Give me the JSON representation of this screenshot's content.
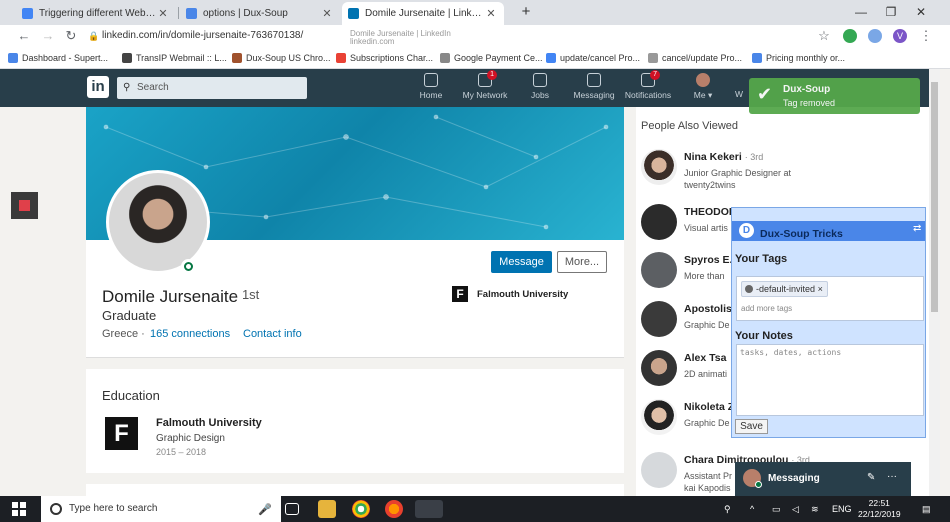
{
  "browser": {
    "tabs": [
      {
        "title": "Triggering different Webhooks fr",
        "icon": "docs-icon",
        "active": false
      },
      {
        "title": "options | Dux-Soup",
        "icon": "duxsoup-icon",
        "active": false
      },
      {
        "title": "Domile Jursenaite | LinkedIn",
        "icon": "linkedin-icon",
        "active": true
      }
    ],
    "new_tab": "+",
    "hover_tooltip": {
      "title": "Domile Jursenaite | LinkedIn",
      "host": "linkedin.com"
    },
    "url": "linkedin.com/in/domile-jursenaite-763670138/",
    "profile_initial": "V",
    "bookmarks": [
      "Dashboard - Supert...",
      "TransIP Webmail :: L...",
      "Dux-Soup US Chro...",
      "Subscriptions Char...",
      "Google Payment Ce...",
      "update/cancel Pro...",
      "cancel/update Pro...",
      "Pricing monthly or..."
    ]
  },
  "linkedin": {
    "logo": "in",
    "search_placeholder": "Search",
    "nav": [
      {
        "label": "Home",
        "badge": "",
        "icon": "home-icon"
      },
      {
        "label": "My Network",
        "badge": "1",
        "icon": "network-icon"
      },
      {
        "label": "Jobs",
        "badge": "",
        "icon": "jobs-icon"
      },
      {
        "label": "Messaging",
        "badge": "",
        "icon": "messaging-icon"
      },
      {
        "label": "Notifications",
        "badge": "7",
        "icon": "bell-icon"
      },
      {
        "label": "Me ▾",
        "badge": "",
        "icon": "me-avatar"
      }
    ],
    "nav_overflow": "W"
  },
  "profile": {
    "name": "Domile Jursenaite",
    "degree": "· 1st",
    "headline": "Graduate",
    "location": "Greece ·",
    "connections": "165 connections",
    "contact_info": "Contact info",
    "message_button": "Message",
    "more_button": "More...",
    "education_logo": "F",
    "education_name": "Falmouth University"
  },
  "education": {
    "title": "Education",
    "school": "Falmouth University",
    "degree": "Graphic Design",
    "years": "2015 – 2018"
  },
  "people_also_viewed": {
    "title": "People Also Viewed",
    "people": [
      {
        "name": "Nina Kekeri",
        "degree": "· 3rd",
        "sub1": "Junior Graphic Designer at",
        "sub2": "twenty2twins"
      },
      {
        "name": "THEODOR",
        "degree": "",
        "sub1": "Visual artis",
        "sub2": ""
      },
      {
        "name": "Spyros E.",
        "degree": "",
        "sub1": "More than",
        "sub2": ""
      },
      {
        "name": "Apostolis",
        "degree": "",
        "sub1": "Graphic De",
        "sub2": ""
      },
      {
        "name": "Alex Tsa",
        "degree": "",
        "sub1": "2D animati",
        "sub2": ""
      },
      {
        "name": "Nikoleta Z",
        "degree": "",
        "sub1": "Graphic De",
        "sub2": ""
      },
      {
        "name": "Chara Dimitropoulou",
        "degree": "· 3rd",
        "sub1": "Assistant Pr",
        "sub2": "kai Kapodis"
      }
    ]
  },
  "dux_toast": {
    "title": "Dux-Soup",
    "message": "Tag removed",
    "color": "#55a74a"
  },
  "dux_panel": {
    "title": "Dux-Soup Tricks",
    "tags_label": "Your Tags",
    "tag": "-default-invited",
    "tag_remove": "×",
    "tag_input_placeholder": "add more tags",
    "notes_label": "Your Notes",
    "notes_placeholder": "tasks, dates, actions",
    "save_button": "Save"
  },
  "messaging": {
    "label": "Messaging",
    "edit": "✎",
    "more": "···"
  },
  "taskbar": {
    "search_placeholder": "Type here to search",
    "language": "ENG",
    "time": "22:51",
    "date": "22/12/2019"
  },
  "colors": {
    "linkedin_header": "#283e4a",
    "linkedin_blue": "#0073b1",
    "dux_blue": "#4a86e8"
  }
}
